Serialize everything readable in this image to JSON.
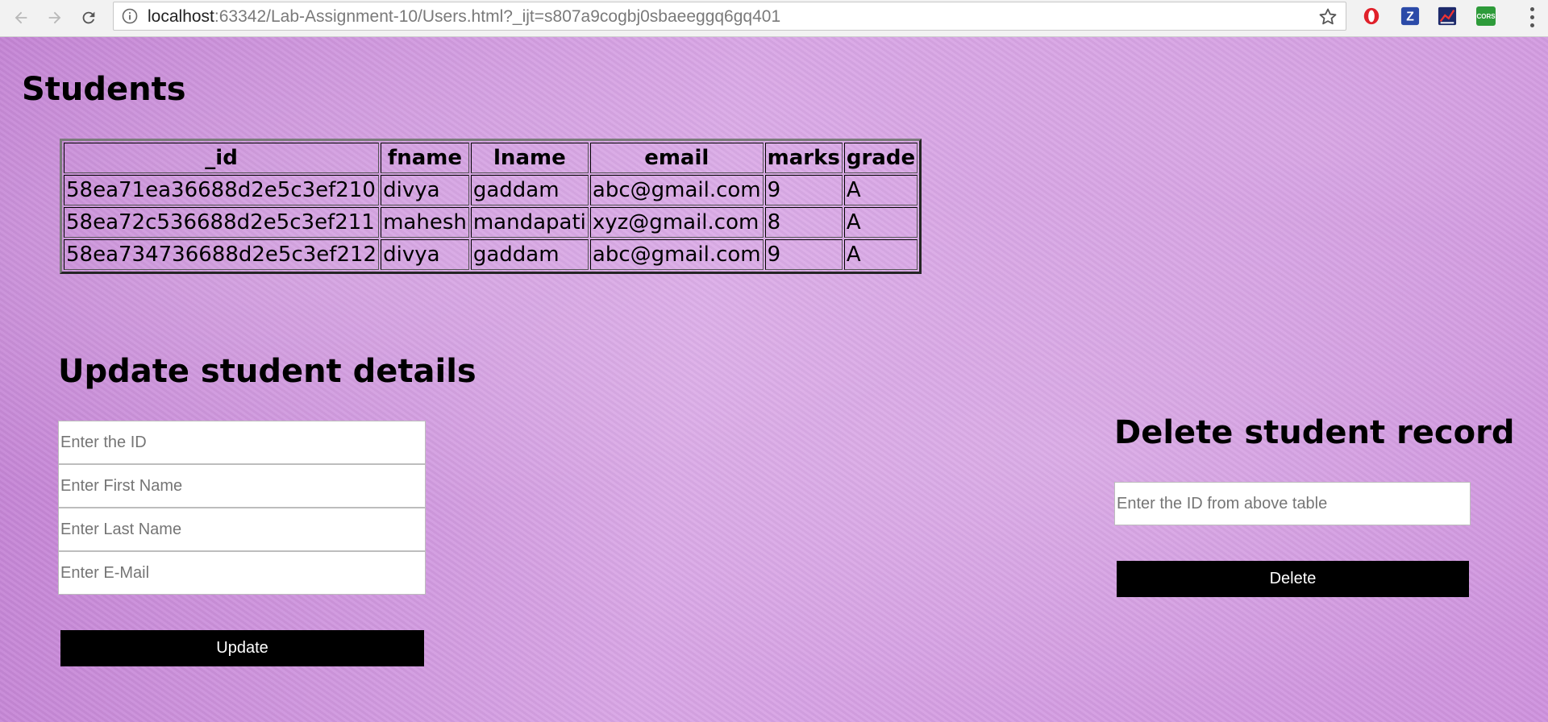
{
  "browser": {
    "url_host": "localhost",
    "url_rest": ":63342/Lab-Assignment-10/Users.html?_ijt=s807a9cogbj0sbaeeggq6gq401",
    "extension_cors_label": "CORS",
    "extension_z_label": "Z"
  },
  "students": {
    "heading": "Students",
    "columns": [
      "_id",
      "fname",
      "lname",
      "email",
      "marks",
      "grade"
    ],
    "rows": [
      [
        "58ea71ea36688d2e5c3ef210",
        "divya",
        "gaddam",
        "abc@gmail.com",
        "9",
        "A"
      ],
      [
        "58ea72c536688d2e5c3ef211",
        "mahesh",
        "mandapati",
        "xyz@gmail.com",
        "8",
        "A"
      ],
      [
        "58ea734736688d2e5c3ef212",
        "divya",
        "gaddam",
        "abc@gmail.com",
        "9",
        "A"
      ]
    ]
  },
  "update": {
    "heading": "Update student details",
    "id_placeholder": "Enter the ID",
    "fname_placeholder": "Enter First Name",
    "lname_placeholder": "Enter Last Name",
    "email_placeholder": "Enter E-Mail",
    "button_label": "Update"
  },
  "delete": {
    "heading": "Delete student record",
    "id_placeholder": "Enter the ID from above table",
    "button_label": "Delete"
  }
}
